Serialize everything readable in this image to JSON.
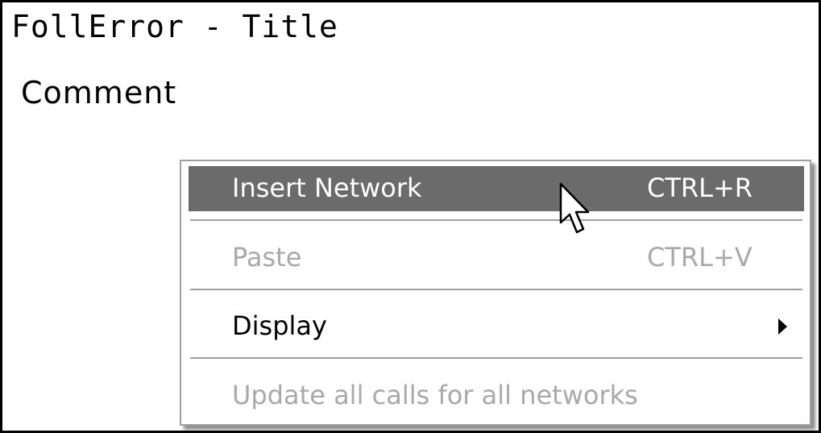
{
  "block": {
    "title": "FollError - Title",
    "comment": "Comment"
  },
  "context_menu": {
    "items": [
      {
        "label": "Insert Network",
        "shortcut": "CTRL+R",
        "state": "highlighted"
      },
      {
        "label": "Paste",
        "shortcut": "CTRL+V",
        "state": "disabled"
      },
      {
        "label": "Display",
        "shortcut": "",
        "state": "enabled",
        "submenu": true
      },
      {
        "label": "Update all calls for all networks",
        "shortcut": "",
        "state": "disabled"
      }
    ]
  },
  "colors": {
    "highlight": "#6b6b6b",
    "disabled_text": "#a9a9a9",
    "menu_border": "#a0a0a0"
  },
  "icons": {
    "pointer": "mouse-pointer-icon",
    "submenu": "submenu-arrow-icon"
  }
}
